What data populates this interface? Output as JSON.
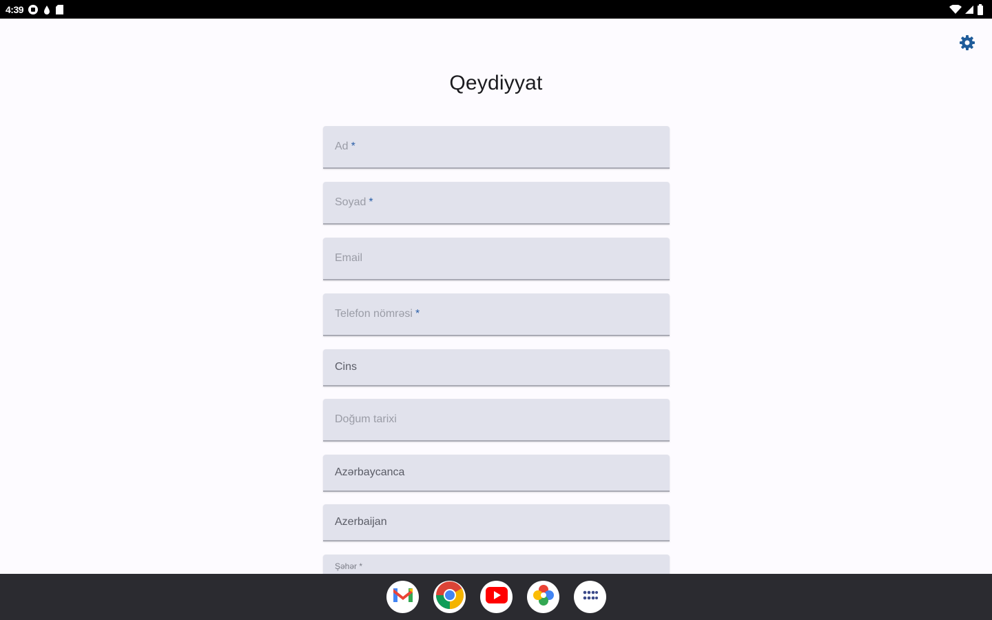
{
  "status_bar": {
    "time": "4:39",
    "icons": [
      "sim-icon",
      "drop-icon",
      "sd-card-icon",
      "wifi-icon",
      "cell-signal-icon",
      "battery-icon"
    ]
  },
  "header": {
    "title": "Qeydiyyat",
    "settings_icon": "gear-icon",
    "accent_color": "#1f5c9a"
  },
  "form": {
    "first_name": {
      "label": "Ad",
      "required_mark": "*"
    },
    "last_name": {
      "label": "Soyad",
      "required_mark": "*"
    },
    "email": {
      "label": "Email"
    },
    "phone": {
      "label": "Telefon nömrəsi",
      "required_mark": "*"
    },
    "gender": {
      "value": "Cins"
    },
    "birth_date": {
      "label": "Doğum tarixi"
    },
    "language": {
      "value": "Azərbaycanca"
    },
    "country": {
      "value": "Azerbaijan"
    },
    "city": {
      "label": "Şəhər *"
    }
  },
  "dock": {
    "apps": [
      "gmail-icon",
      "chrome-icon",
      "youtube-icon",
      "photos-icon",
      "app-drawer-icon"
    ]
  }
}
